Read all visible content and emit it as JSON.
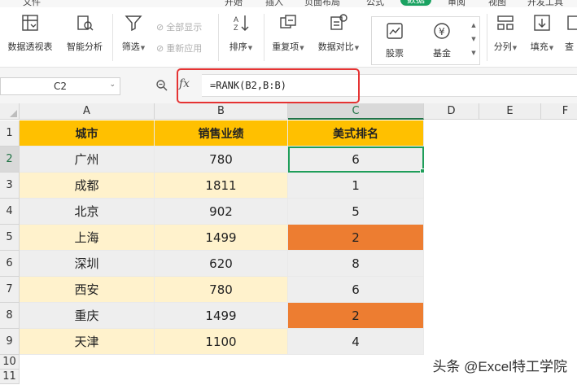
{
  "menu_tabs": [
    {
      "label": "文件",
      "active": false
    },
    {
      "label": "开始",
      "active": false
    },
    {
      "label": "插入",
      "active": false
    },
    {
      "label": "页面布局",
      "active": false
    },
    {
      "label": "公式",
      "active": false
    },
    {
      "label": "数据",
      "active": true
    },
    {
      "label": "审阅",
      "active": false
    },
    {
      "label": "视图",
      "active": false
    },
    {
      "label": "开发工具",
      "active": false
    }
  ],
  "ribbon": {
    "pivot_table": "数据透视表",
    "smart_analysis": "智能分析",
    "filter": "筛选",
    "show_all": "全部显示",
    "reapply": "重新应用",
    "sort": "排序",
    "duplicates": "重复项",
    "compare": "数据对比",
    "stocks": "股票",
    "fund": "基金",
    "split": "分列",
    "fill": "填充",
    "lookup": "查"
  },
  "formula_bar": {
    "name_box": "C2",
    "fx_label": "fx",
    "formula": "=RANK(B2,B:B)"
  },
  "columns": [
    "A",
    "B",
    "C",
    "D",
    "E",
    "F"
  ],
  "selected_column": "C",
  "selected_row": 2,
  "rows": [
    "1",
    "2",
    "3",
    "4",
    "5",
    "6",
    "7",
    "8",
    "9",
    "10",
    "11"
  ],
  "table": {
    "headers": [
      "城市",
      "销售业绩",
      "美式排名"
    ],
    "data": [
      {
        "city": "广州",
        "sales": "780",
        "rank": "6",
        "highlight": false
      },
      {
        "city": "成都",
        "sales": "1811",
        "rank": "1",
        "highlight": false
      },
      {
        "city": "北京",
        "sales": "902",
        "rank": "5",
        "highlight": false
      },
      {
        "city": "上海",
        "sales": "1499",
        "rank": "2",
        "highlight": true
      },
      {
        "city": "深圳",
        "sales": "620",
        "rank": "8",
        "highlight": false
      },
      {
        "city": "西安",
        "sales": "780",
        "rank": "6",
        "highlight": false
      },
      {
        "city": "重庆",
        "sales": "1499",
        "rank": "2",
        "highlight": true
      },
      {
        "city": "天津",
        "sales": "1100",
        "rank": "4",
        "highlight": false
      }
    ]
  },
  "colors": {
    "header_fill": "#ffc000",
    "cream_fill": "#fff2cc",
    "gray_fill": "#eeeeee",
    "highlight_fill": "#ed7d31",
    "active_border": "#1f9e5a",
    "annotation_border": "#e53333",
    "tab_active": "#1aa261"
  },
  "watermark": "头条 @Excel特工学院"
}
